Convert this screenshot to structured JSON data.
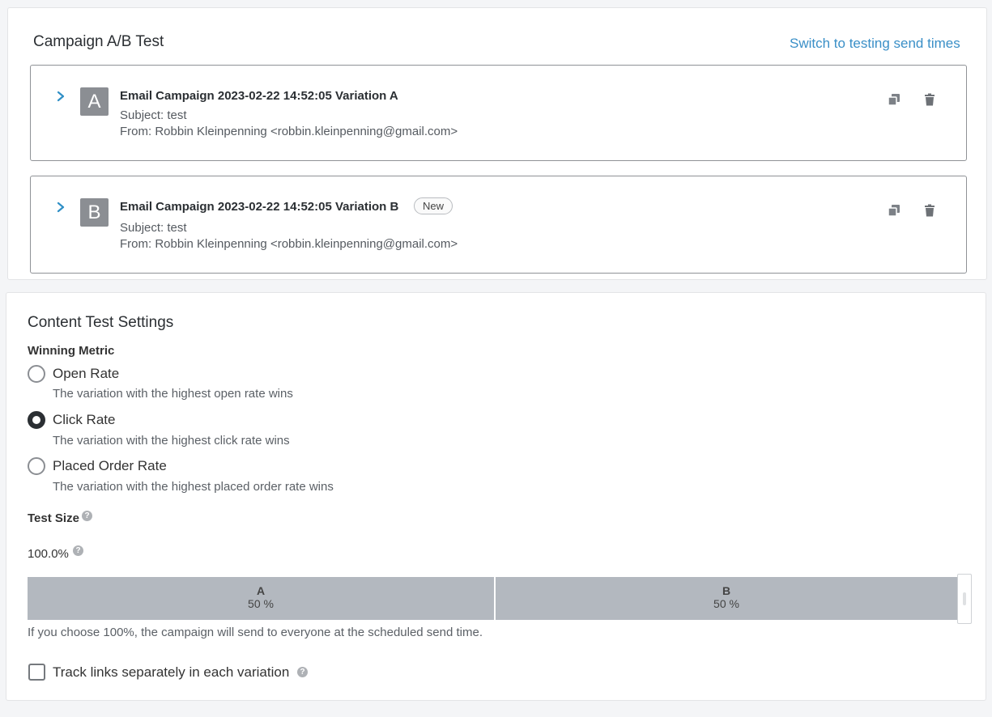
{
  "ab_test": {
    "title": "Campaign A/B Test",
    "switch_link": "Switch to testing send times",
    "variations": [
      {
        "letter": "A",
        "name": "Email Campaign 2023-02-22 14:52:05 Variation A",
        "subject": "Subject: test",
        "from": "From: Robbin Kleinpenning <robbin.kleinpenning@gmail.com>",
        "tag": ""
      },
      {
        "letter": "B",
        "name": "Email Campaign 2023-02-22 14:52:05 Variation B",
        "subject": "Subject: test",
        "from": "From: Robbin Kleinpenning <robbin.kleinpenning@gmail.com>",
        "tag": "New"
      }
    ],
    "icons": [
      "chevron-right-icon",
      "copy-icon",
      "trash-icon"
    ],
    "accent_color": "#3a8fc7"
  },
  "settings": {
    "title": "Content Test Settings",
    "winning_metric_label": "Winning Metric",
    "options": [
      {
        "label": "Open Rate",
        "help": "The variation with the highest open rate wins",
        "selected": false
      },
      {
        "label": "Click Rate",
        "help": "The variation with the highest click rate wins",
        "selected": true
      },
      {
        "label": "Placed Order Rate",
        "help": "The variation with the highest placed order rate wins",
        "selected": false
      }
    ],
    "test_size_label": "Test Size",
    "test_size_value": "100.0%",
    "split": [
      {
        "label": "A",
        "percent": "50 %",
        "share": 0.5
      },
      {
        "label": "B",
        "percent": "50 %",
        "share": 0.5
      }
    ],
    "split_note": "If you choose 100%, the campaign will send to everyone at the scheduled send time.",
    "track_links_label": "Track links separately in each variation",
    "track_links_checked": false,
    "help_symbol": "?"
  }
}
